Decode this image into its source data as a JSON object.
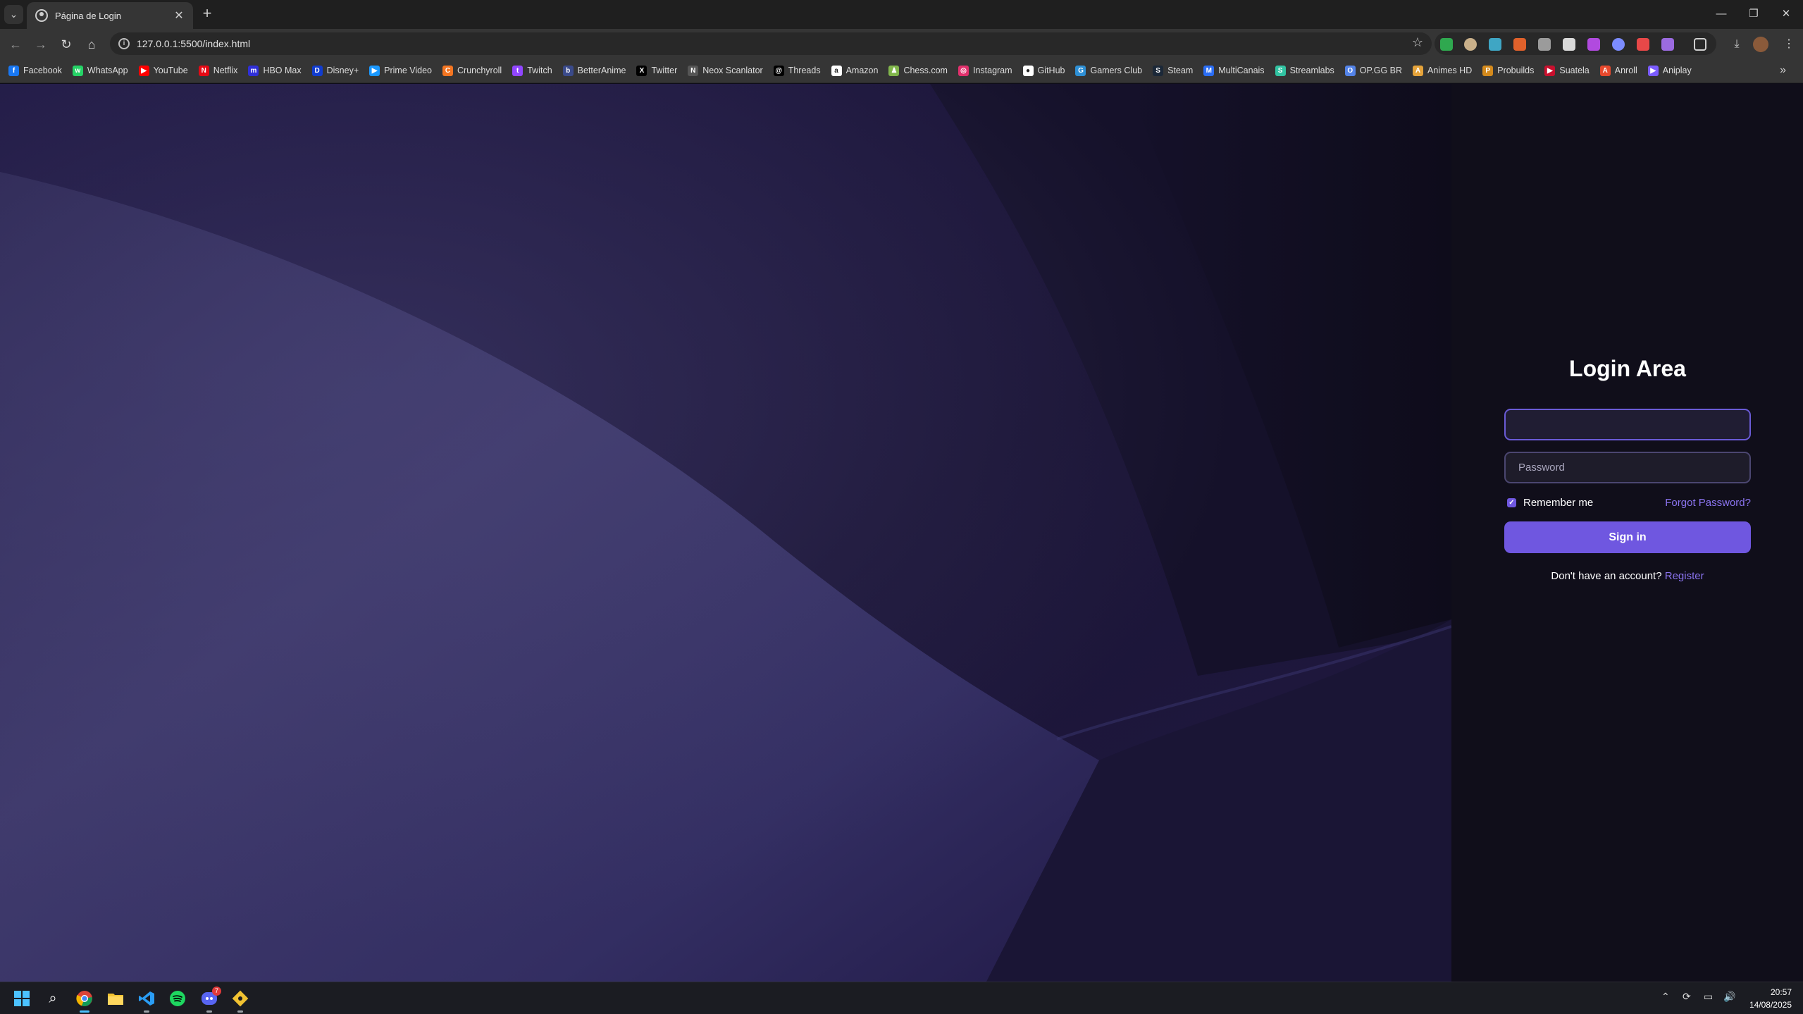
{
  "browser": {
    "tab": {
      "title": "Página de Login"
    },
    "url": "127.0.0.1:5500/index.html",
    "bookmarks": [
      {
        "label": "Facebook",
        "color": "#1877f2",
        "glyph": "f"
      },
      {
        "label": "WhatsApp",
        "color": "#25d366",
        "glyph": "w"
      },
      {
        "label": "YouTube",
        "color": "#ff0000",
        "glyph": "▶"
      },
      {
        "label": "Netflix",
        "color": "#e50914",
        "glyph": "N"
      },
      {
        "label": "HBO Max",
        "color": "#2f2fd8",
        "glyph": "m"
      },
      {
        "label": "Disney+",
        "color": "#113ccf",
        "glyph": "D"
      },
      {
        "label": "Prime Video",
        "color": "#1a98ff",
        "glyph": "▶"
      },
      {
        "label": "Crunchyroll",
        "color": "#f47521",
        "glyph": "C"
      },
      {
        "label": "Twitch",
        "color": "#9146ff",
        "glyph": "t"
      },
      {
        "label": "BetterAnime",
        "color": "#3a4a8a",
        "glyph": "b"
      },
      {
        "label": "Twitter",
        "color": "#000000",
        "glyph": "X"
      },
      {
        "label": "Neox Scanlator",
        "color": "#555555",
        "glyph": "N"
      },
      {
        "label": "Threads",
        "color": "#000000",
        "glyph": "@"
      },
      {
        "label": "Amazon",
        "color": "#ffffff",
        "glyph": "a"
      },
      {
        "label": "Chess.com",
        "color": "#81b64c",
        "glyph": "♟"
      },
      {
        "label": "Instagram",
        "color": "#e1306c",
        "glyph": "◎"
      },
      {
        "label": "GitHub",
        "color": "#ffffff",
        "glyph": "●"
      },
      {
        "label": "Gamers Club",
        "color": "#2d8fd5",
        "glyph": "G"
      },
      {
        "label": "Steam",
        "color": "#1b2838",
        "glyph": "S"
      },
      {
        "label": "MultiCanais",
        "color": "#2a6df4",
        "glyph": "M"
      },
      {
        "label": "Streamlabs",
        "color": "#31c3a2",
        "glyph": "S"
      },
      {
        "label": "OP.GG BR",
        "color": "#5383e8",
        "glyph": "O"
      },
      {
        "label": "Animes HD",
        "color": "#e5a33a",
        "glyph": "A"
      },
      {
        "label": "Probuilds",
        "color": "#d48a1c",
        "glyph": "P"
      },
      {
        "label": "Suatela",
        "color": "#c8102e",
        "glyph": "▶"
      },
      {
        "label": "Anroll",
        "color": "#e8492d",
        "glyph": "A"
      },
      {
        "label": "Aniplay",
        "color": "#7b5cff",
        "glyph": "▶"
      }
    ]
  },
  "login": {
    "title": "Login Area",
    "username_value": "",
    "password_placeholder": "Password",
    "remember_label": "Remember me",
    "forgot_label": "Forgot Password?",
    "signin_label": "Sign in",
    "no_account_text": "Don't have an account?",
    "register_label": "Register"
  },
  "colors": {
    "accent": "#6f57e0",
    "link": "#8b74f0",
    "panel_bg": "#100e1a"
  },
  "taskbar": {
    "time": "20:57",
    "date": "14/08/2025",
    "discord_badge": "7"
  }
}
